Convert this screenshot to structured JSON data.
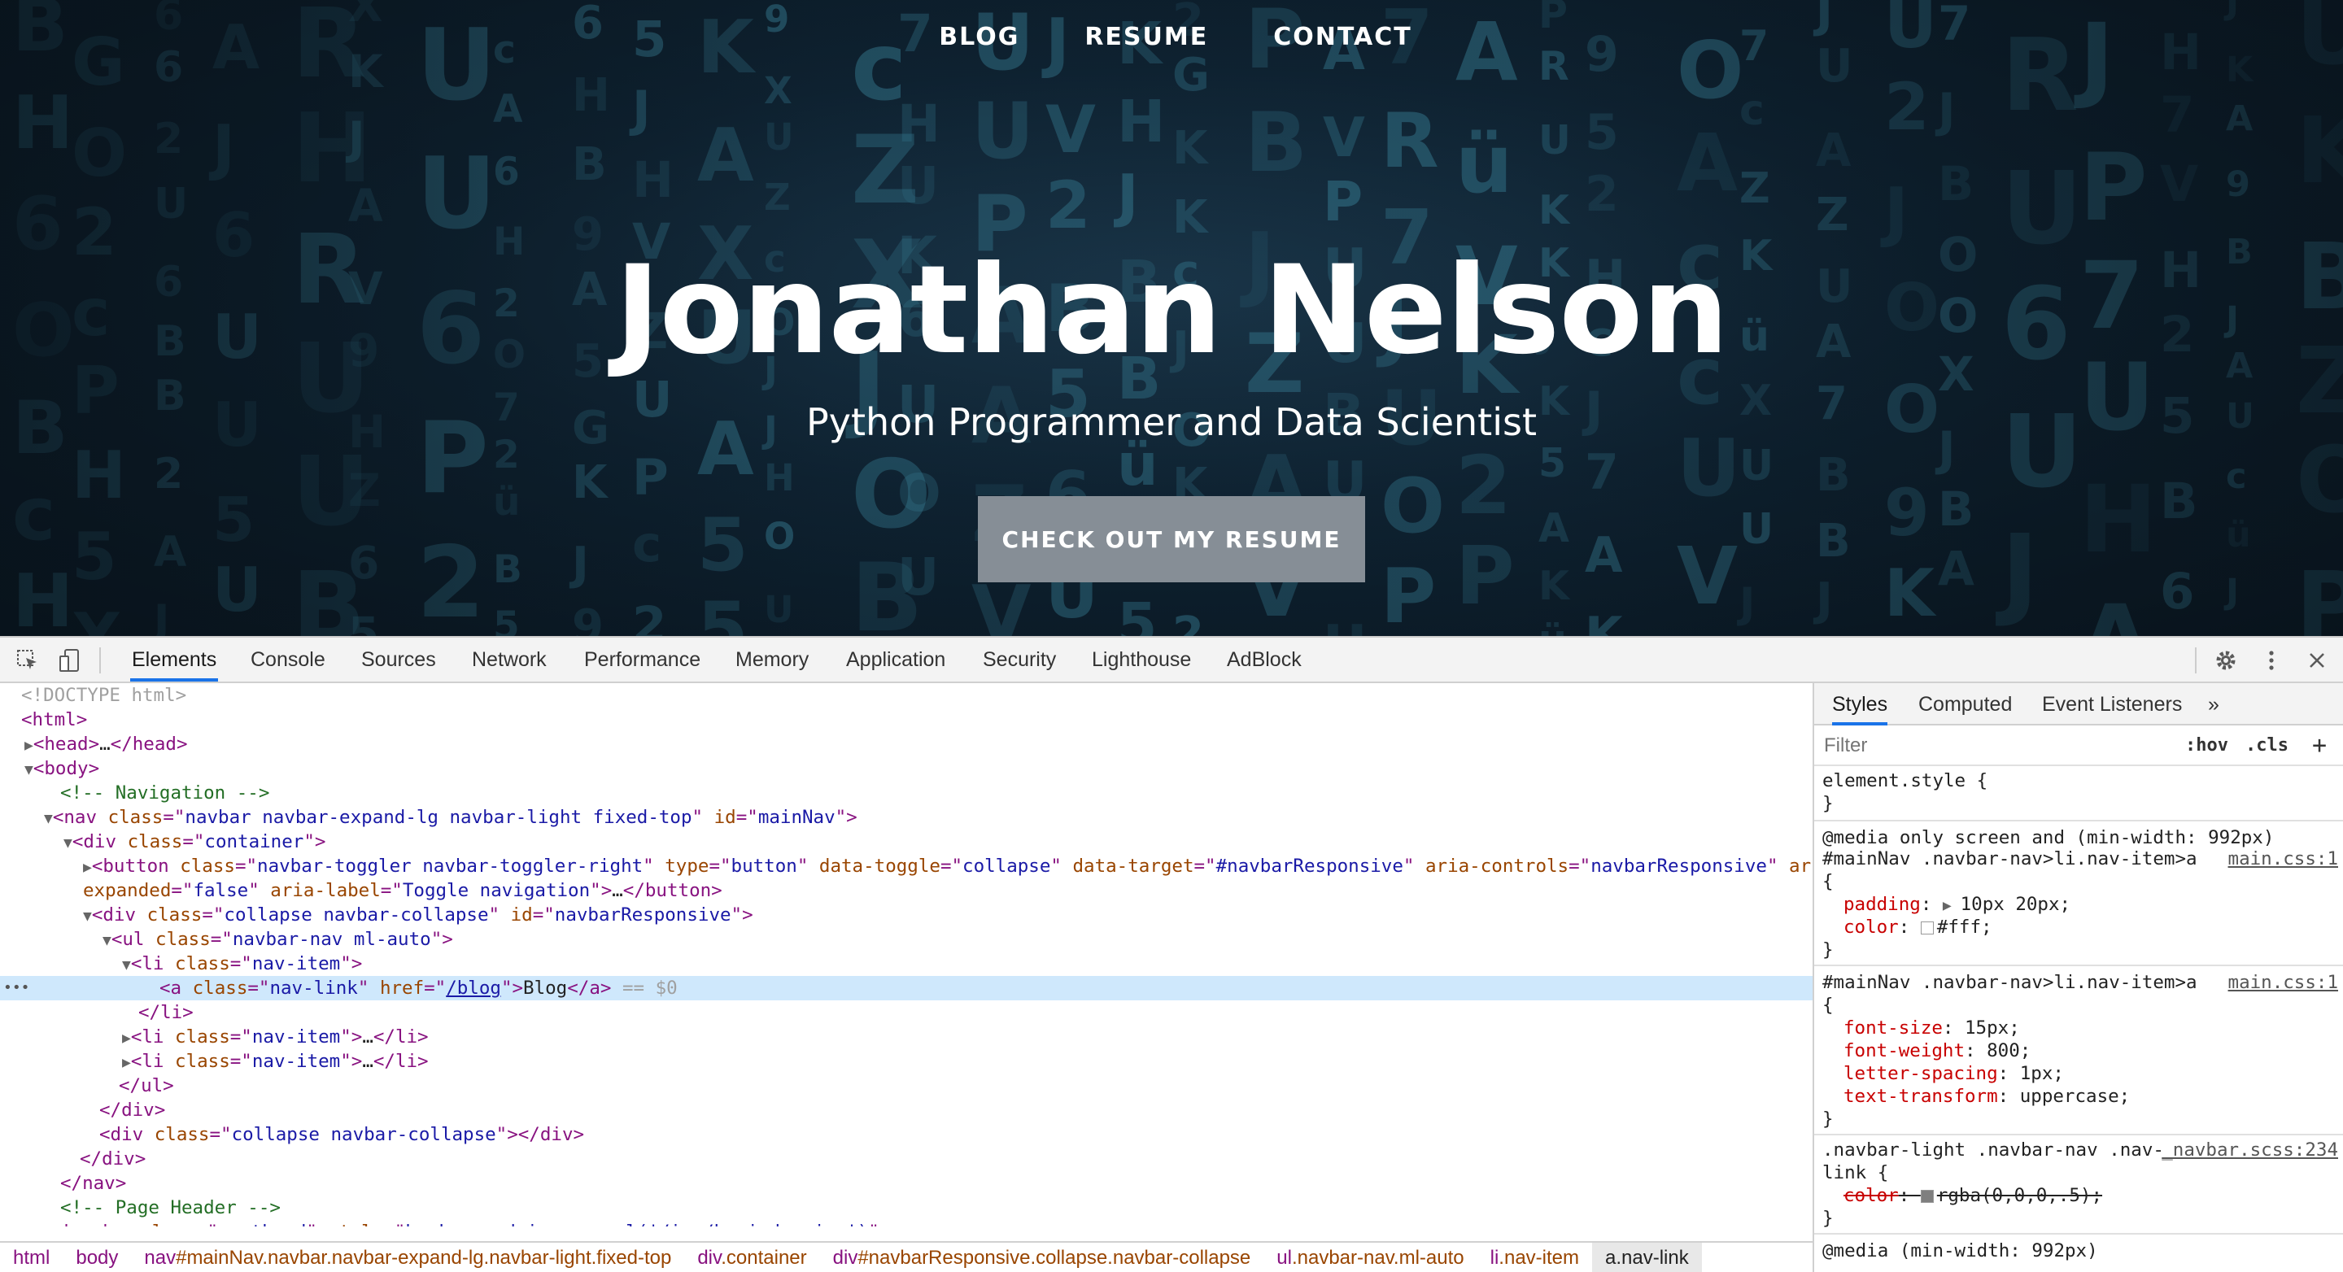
{
  "site": {
    "nav": [
      "BLOG",
      "RESUME",
      "CONTACT"
    ],
    "title": "Jonathan Nelson",
    "subtitle": "Python Programmer and Data Scientist",
    "cta": "CHECK OUT MY RESUME"
  },
  "devtools": {
    "tabs": [
      "Elements",
      "Console",
      "Sources",
      "Network",
      "Performance",
      "Memory",
      "Application",
      "Security",
      "Lighthouse",
      "AdBlock"
    ],
    "active_tab": "Elements",
    "icons": [
      "inspect-element-icon",
      "device-toolbar-icon",
      "settings-gear-icon",
      "more-options-icon",
      "close-icon"
    ],
    "breadcrumb": [
      {
        "tag": "html",
        "rest": ""
      },
      {
        "tag": "body",
        "rest": ""
      },
      {
        "tag": "nav",
        "rest": "#mainNav.navbar.navbar-expand-lg.navbar-light.fixed-top"
      },
      {
        "tag": "div",
        "rest": ".container"
      },
      {
        "tag": "div",
        "rest": "#navbarResponsive.collapse.navbar-collapse"
      },
      {
        "tag": "ul",
        "rest": ".navbar-nav.ml-auto"
      },
      {
        "tag": "li",
        "rest": ".nav-item"
      },
      {
        "tag": "a",
        "rest": ".nav-link"
      }
    ],
    "dom": {
      "doctype": "<!DOCTYPE html>",
      "comment_nav": "<!-- Navigation -->",
      "comment_header": "<!-- Page Header -->",
      "selected_text": "Blog",
      "selected_href": "/blog",
      "selected_marker": "== $0"
    },
    "styles": {
      "tabs": [
        "Styles",
        "Computed",
        "Event Listeners"
      ],
      "more_tabs": "»",
      "filter_placeholder": "Filter",
      "hov": ":hov",
      "cls": ".cls",
      "add": "+",
      "rules": [
        {
          "selector": "element.style {",
          "source": "",
          "props": []
        },
        {
          "media": "@media only screen and (min-width: 992px)",
          "selector": "#mainNav .navbar-nav>li.nav-item>a",
          "source": "main.css:1",
          "props": [
            [
              "padding",
              "10px 20px;"
            ],
            [
              "color",
              "#fff;"
            ]
          ]
        },
        {
          "selector": "#mainNav .navbar-nav>li.nav-item>a",
          "source": "main.css:1",
          "props": [
            [
              "font-size",
              "15px;"
            ],
            [
              "font-weight",
              "800;"
            ],
            [
              "letter-spacing",
              "1px;"
            ],
            [
              "text-transform",
              "uppercase;"
            ]
          ]
        },
        {
          "selector": ".navbar-light .navbar-nav .nav-link {",
          "source": "_navbar.scss:234",
          "props": [
            [
              "color",
              "rgba(0,0,0,.5);"
            ]
          ]
        },
        {
          "media": "@media (min-width: 992px)",
          "selector": "",
          "source": "",
          "props": []
        }
      ]
    }
  },
  "colors": {
    "selected_line": "#cfe8fc",
    "active_tab_underline": "#1a73e8",
    "button_gray": "#868e96"
  }
}
